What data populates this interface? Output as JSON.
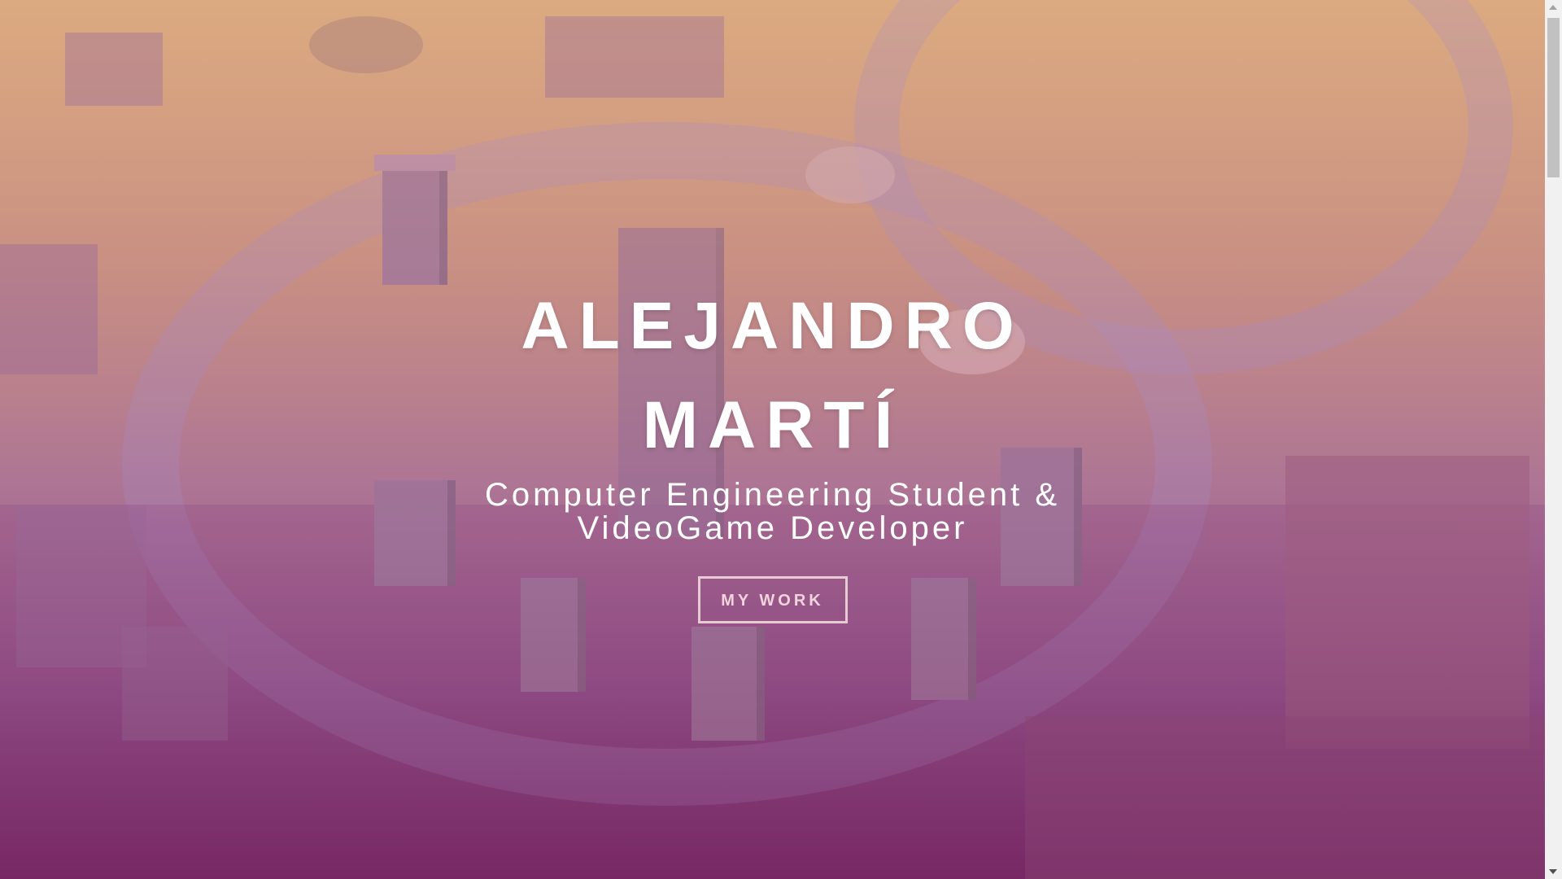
{
  "hero": {
    "name_line1": "ALEJANDRO",
    "name_line2": "MARTÍ",
    "subtitle_line1": "Computer Engineering Student &",
    "subtitle_line2": "VideoGame Developer",
    "work_button_label": "MY WORK"
  },
  "background": {
    "description_icon": "desert-landscape-image",
    "colors": {
      "top": "#d8a77c",
      "middle": "#b07894",
      "bottom": "#7c2f6a"
    }
  },
  "colors": {
    "text": "#ffffff",
    "button_border": "#f5e1e1",
    "scrollbar_track": "#f1f1f1",
    "scrollbar_thumb": "#c1c1c1"
  }
}
